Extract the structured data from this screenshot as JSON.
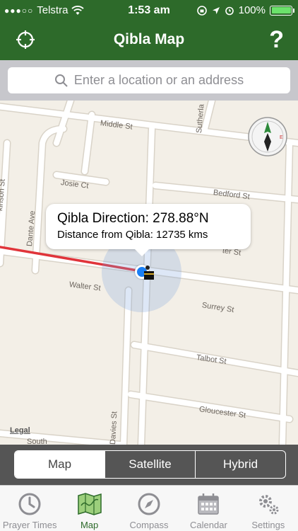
{
  "status_bar": {
    "signal_dots": "●●●○○",
    "carrier": "Telstra",
    "time": "1:53 am",
    "battery": "100%",
    "battery_level": 1.0
  },
  "nav": {
    "title": "Qibla Map",
    "help_label": "?",
    "locate_icon": "crosshair-icon"
  },
  "search": {
    "placeholder": "Enter a location or an address"
  },
  "map": {
    "streets": [
      "Middle St",
      "Sutherla",
      "Josie Ct",
      "Bedford St",
      "Dante Ave",
      "Walter St",
      "Surrey St",
      "Talbot St",
      "Gloucester St",
      "Davies St",
      "South",
      "kinson St",
      "ter St"
    ],
    "legal": "Legal",
    "callout": {
      "direction": "Qibla Direction: 278.88°N",
      "distance": "Distance from Qibla: 12735 kms"
    },
    "qibla_line_color": "#e0343a",
    "user_dot_color": "#1a7ff5"
  },
  "segments": {
    "items": [
      "Map",
      "Satellite",
      "Hybrid"
    ],
    "selected": "Map"
  },
  "tabs": [
    {
      "label": "Prayer Times",
      "icon": "clock-icon"
    },
    {
      "label": "Map",
      "icon": "map-icon",
      "active": true
    },
    {
      "label": "Compass",
      "icon": "compass-icon"
    },
    {
      "label": "Calendar",
      "icon": "calendar-icon"
    },
    {
      "label": "Settings",
      "icon": "gears-icon"
    }
  ],
  "colors": {
    "brand_green": "#2d6a2a",
    "active_tab": "#2d6a2a"
  }
}
